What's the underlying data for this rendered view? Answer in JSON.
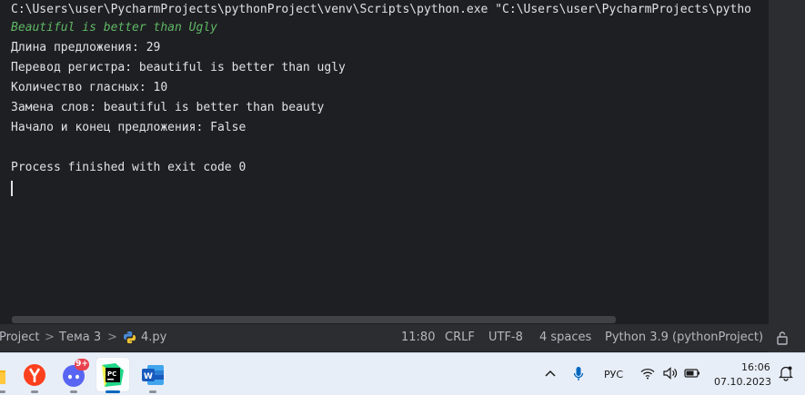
{
  "console": {
    "lines": [
      "C:\\Users\\user\\PycharmProjects\\pythonProject\\venv\\Scripts\\python.exe \"C:\\Users\\user\\PycharmProjects\\pytho",
      "Beautiful is better than Ugly",
      "Длина предложения: 29",
      "Перевод регистра: beautiful is better than ugly",
      "Количество гласных: 10",
      "Замена слов: beautiful is better than beauty",
      "Начало и конец предложения: False",
      "",
      "Process finished with exit code 0"
    ],
    "echo_color": "#5fb865"
  },
  "statusbar": {
    "breadcrumb": [
      "Project",
      "Тема 3",
      "4.py"
    ],
    "separator": ">",
    "file_icon": "python-file-icon",
    "position": "11:80",
    "line_separator": "CRLF",
    "encoding": "UTF-8",
    "indent": "4 spaces",
    "interpreter": "Python 3.9 (pythonProject)",
    "lock_icon": "lock-icon"
  },
  "taskbar": {
    "apps": [
      {
        "name": "folder-app-icon"
      },
      {
        "name": "yandex-browser-icon"
      },
      {
        "name": "discord-icon",
        "badge": "9+"
      },
      {
        "name": "pycharm-icon",
        "active": true
      },
      {
        "name": "word-icon"
      }
    ],
    "tray": {
      "language": "РУС",
      "time": "16:06",
      "date": "07.10.2023"
    },
    "accent": "#0067c0"
  }
}
